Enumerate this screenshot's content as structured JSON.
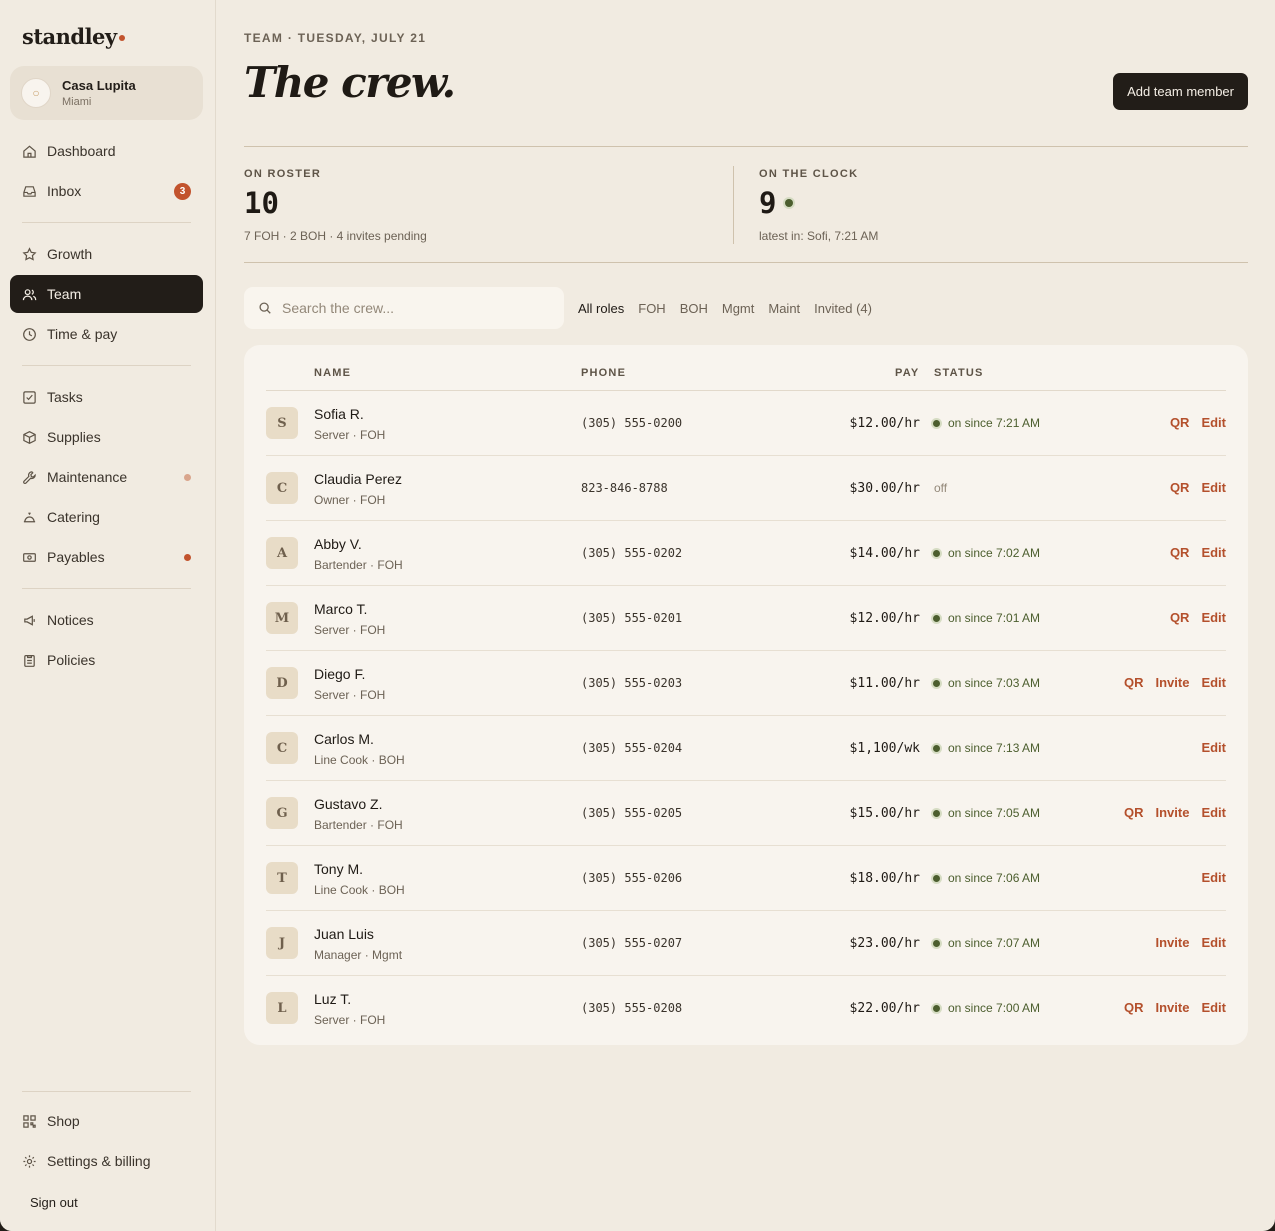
{
  "brand": {
    "name": "standley",
    "accent": "#c2532d"
  },
  "venue": {
    "name": "Casa Lupita",
    "city": "Miami"
  },
  "nav": {
    "dashboard": "Dashboard",
    "inbox": "Inbox",
    "inbox_badge": "3",
    "growth": "Growth",
    "team": "Team",
    "time_pay": "Time & pay",
    "tasks": "Tasks",
    "supplies": "Supplies",
    "maintenance": "Maintenance",
    "catering": "Catering",
    "payables": "Payables",
    "notices": "Notices",
    "policies": "Policies",
    "shop": "Shop",
    "settings": "Settings & billing",
    "signout": "Sign out"
  },
  "header": {
    "eyebrow": "TEAM · TUESDAY, JULY 21",
    "title": "The crew.",
    "add_button": "Add team member"
  },
  "stats": {
    "roster_label": "ON ROSTER",
    "roster_value": "10",
    "roster_sub": "7 FOH · 2 BOH · 4 invites pending",
    "clock_label": "ON THE CLOCK",
    "clock_value": "9",
    "clock_sub": "latest in: Sofi, 7:21 AM"
  },
  "search": {
    "placeholder": "Search the crew..."
  },
  "filters": [
    "All roles",
    "FOH",
    "BOH",
    "Mgmt",
    "Maint",
    "Invited (4)"
  ],
  "table": {
    "columns": {
      "name": "NAME",
      "phone": "PHONE",
      "pay": "PAY",
      "status": "STATUS"
    },
    "rows": [
      {
        "initial": "S",
        "name": "Sofia R.",
        "role": "Server · FOH",
        "phone": "(305) 555-0200",
        "pay": "$12.00/hr",
        "status": "on since 7:21 AM",
        "on": true,
        "actions": [
          "QR",
          "Edit"
        ]
      },
      {
        "initial": "C",
        "name": "Claudia Perez",
        "role": "Owner · FOH",
        "phone": "823-846-8788",
        "pay": "$30.00/hr",
        "status": "off",
        "on": false,
        "actions": [
          "QR",
          "Edit"
        ]
      },
      {
        "initial": "A",
        "name": "Abby V.",
        "role": "Bartender · FOH",
        "phone": "(305) 555-0202",
        "pay": "$14.00/hr",
        "status": "on since 7:02 AM",
        "on": true,
        "actions": [
          "QR",
          "Edit"
        ]
      },
      {
        "initial": "M",
        "name": "Marco T.",
        "role": "Server · FOH",
        "phone": "(305) 555-0201",
        "pay": "$12.00/hr",
        "status": "on since 7:01 AM",
        "on": true,
        "actions": [
          "QR",
          "Edit"
        ]
      },
      {
        "initial": "D",
        "name": "Diego F.",
        "role": "Server · FOH",
        "phone": "(305) 555-0203",
        "pay": "$11.00/hr",
        "status": "on since 7:03 AM",
        "on": true,
        "actions": [
          "QR",
          "Invite",
          "Edit"
        ]
      },
      {
        "initial": "C",
        "name": "Carlos M.",
        "role": "Line Cook · BOH",
        "phone": "(305) 555-0204",
        "pay": "$1,100/wk",
        "status": "on since 7:13 AM",
        "on": true,
        "actions": [
          "Edit"
        ]
      },
      {
        "initial": "G",
        "name": "Gustavo Z.",
        "role": "Bartender · FOH",
        "phone": "(305) 555-0205",
        "pay": "$15.00/hr",
        "status": "on since 7:05 AM",
        "on": true,
        "actions": [
          "QR",
          "Invite",
          "Edit"
        ]
      },
      {
        "initial": "T",
        "name": "Tony M.",
        "role": "Line Cook · BOH",
        "phone": "(305) 555-0206",
        "pay": "$18.00/hr",
        "status": "on since 7:06 AM",
        "on": true,
        "actions": [
          "Edit"
        ]
      },
      {
        "initial": "J",
        "name": "Juan Luis",
        "role": "Manager · Mgmt",
        "phone": "(305) 555-0207",
        "pay": "$23.00/hr",
        "status": "on since 7:07 AM",
        "on": true,
        "actions": [
          "Invite",
          "Edit"
        ]
      },
      {
        "initial": "L",
        "name": "Luz T.",
        "role": "Server · FOH",
        "phone": "(305) 555-0208",
        "pay": "$22.00/hr",
        "status": "on since 7:00 AM",
        "on": true,
        "actions": [
          "QR",
          "Invite",
          "Edit"
        ]
      }
    ]
  }
}
